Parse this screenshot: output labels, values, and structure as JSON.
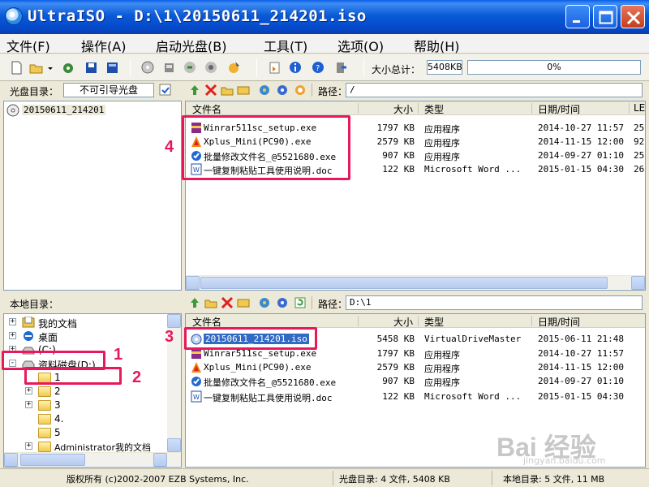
{
  "window": {
    "title": "UltraISO - D:\\1\\20150611_214201.iso",
    "buttons": [
      "minimize-icon",
      "maximize-icon",
      "close-icon"
    ]
  },
  "menu": [
    "文件(F)",
    "操作(A)",
    "启动光盘(B)",
    "工具(T)",
    "选项(O)",
    "帮助(H)"
  ],
  "toolbar": {
    "size_label": "大小总计：",
    "size_value": "5408KB",
    "progress": "0%"
  },
  "disc_panel": {
    "label": "光盘目录：",
    "boot_label": "不可引导光盘",
    "path_label": "路径：",
    "path": "/",
    "tree_root": "20150611_214201",
    "columns": [
      "文件名",
      "大小",
      "类型",
      "日期/时间",
      "LE"
    ],
    "files": [
      {
        "icon": "winrar-icon",
        "name": "Winrar511sc_setup.exe",
        "size": "1797 KB",
        "type": "应用程序",
        "date": "2014-10-27 11:57",
        "le": "25"
      },
      {
        "icon": "xplus-icon",
        "name": "Xplus_Mini(PC90).exe",
        "size": "2579 KB",
        "type": "应用程序",
        "date": "2014-11-15 12:00",
        "le": "92"
      },
      {
        "icon": "rename-tool-icon",
        "name": "批量修改文件名_@5521680.exe",
        "size": "907 KB",
        "type": "应用程序",
        "date": "2014-09-27 01:10",
        "le": "25"
      },
      {
        "icon": "word-doc-icon",
        "name": "一键复制粘贴工具使用说明.doc",
        "size": "122 KB",
        "type": "Microsoft Word ...",
        "date": "2015-01-15 04:30",
        "le": "26"
      }
    ]
  },
  "local_panel": {
    "label": "本地目录：",
    "path_label": "路径：",
    "path": "D:\\1",
    "tree": [
      {
        "label": "我的文档",
        "icon": "my-documents-icon",
        "exp": "+"
      },
      {
        "label": "桌面",
        "icon": "desktop-icon",
        "exp": "+"
      },
      {
        "label": "(C:)",
        "icon": "drive-icon",
        "exp": "+"
      },
      {
        "label": "资料磁盘(D:)",
        "icon": "drive-icon",
        "exp": "-"
      },
      {
        "label": "1",
        "icon": "folder-icon",
        "exp": ""
      },
      {
        "label": "2",
        "icon": "folder-icon",
        "exp": "+"
      },
      {
        "label": "3",
        "icon": "folder-icon",
        "exp": "+"
      },
      {
        "label": "4.",
        "icon": "folder-icon",
        "exp": ""
      },
      {
        "label": "5",
        "icon": "folder-icon",
        "exp": ""
      },
      {
        "label": "Administrator我的文档",
        "icon": "folder-icon",
        "exp": "+"
      }
    ],
    "columns": [
      "文件名",
      "大小",
      "类型",
      "日期/时间"
    ],
    "files": [
      {
        "icon": "iso-file-icon",
        "name": "20150611_214201.iso",
        "size": "5458 KB",
        "type": "VirtualDriveMaster",
        "date": "2015-06-11 21:48",
        "selected": true
      },
      {
        "icon": "winrar-icon",
        "name": "Winrar511sc_setup.exe",
        "size": "1797 KB",
        "type": "应用程序",
        "date": "2014-10-27 11:57"
      },
      {
        "icon": "xplus-icon",
        "name": "Xplus_Mini(PC90).exe",
        "size": "2579 KB",
        "type": "应用程序",
        "date": "2014-11-15 12:00"
      },
      {
        "icon": "rename-tool-icon",
        "name": "批量修改文件名_@5521680.exe",
        "size": "907 KB",
        "type": "应用程序",
        "date": "2014-09-27 01:10"
      },
      {
        "icon": "word-doc-icon",
        "name": "一键复制粘贴工具使用说明.doc",
        "size": "122 KB",
        "type": "Microsoft Word ...",
        "date": "2015-01-15 04:30"
      }
    ]
  },
  "status": {
    "copyright": "版权所有 (c)2002-2007 EZB Systems, Inc.",
    "disc_summary": "光盘目录: 4 文件, 5408 KB",
    "local_summary": "本地目录: 5 文件, 11 MB"
  },
  "annotations": [
    "1",
    "2",
    "3",
    "4"
  ],
  "watermark": {
    "brand": "Bai 经验",
    "sub": "jingyan.baidu.com"
  },
  "colors": {
    "title_bar": "#0a5ad8",
    "highlight": "#e8195a",
    "selection": "#316ac5"
  }
}
